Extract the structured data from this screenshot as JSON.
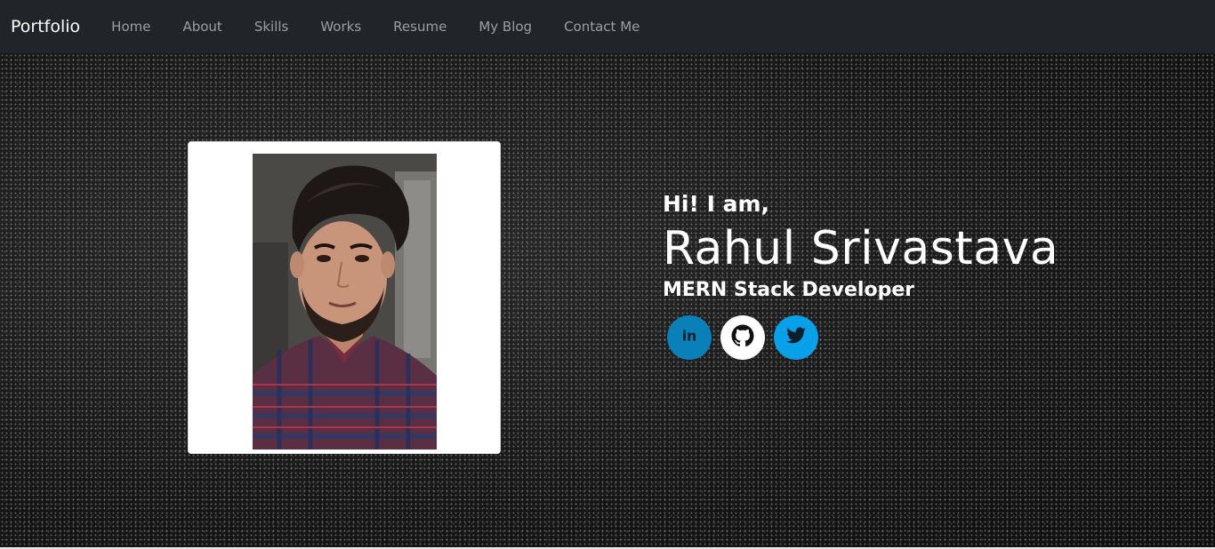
{
  "navbar": {
    "brand": "Portfolio",
    "items": [
      {
        "label": "Home"
      },
      {
        "label": "About"
      },
      {
        "label": "Skills"
      },
      {
        "label": "Works"
      },
      {
        "label": "Resume"
      },
      {
        "label": "My Blog"
      },
      {
        "label": "Contact Me"
      }
    ]
  },
  "hero": {
    "greeting": "Hi! I am,",
    "name": "Rahul Srivastava",
    "role": "MERN Stack Developer",
    "photo_icon": "profile-photo",
    "socials": [
      {
        "icon": "linkedin-icon",
        "color": "#0a80b8"
      },
      {
        "icon": "github-icon",
        "color": "#ffffff"
      },
      {
        "icon": "twitter-icon",
        "color": "#08a0e9"
      }
    ]
  },
  "colors": {
    "navbar_bg": "#212529",
    "nav_text": "#8b8d90",
    "hero_text": "#ffffff"
  }
}
